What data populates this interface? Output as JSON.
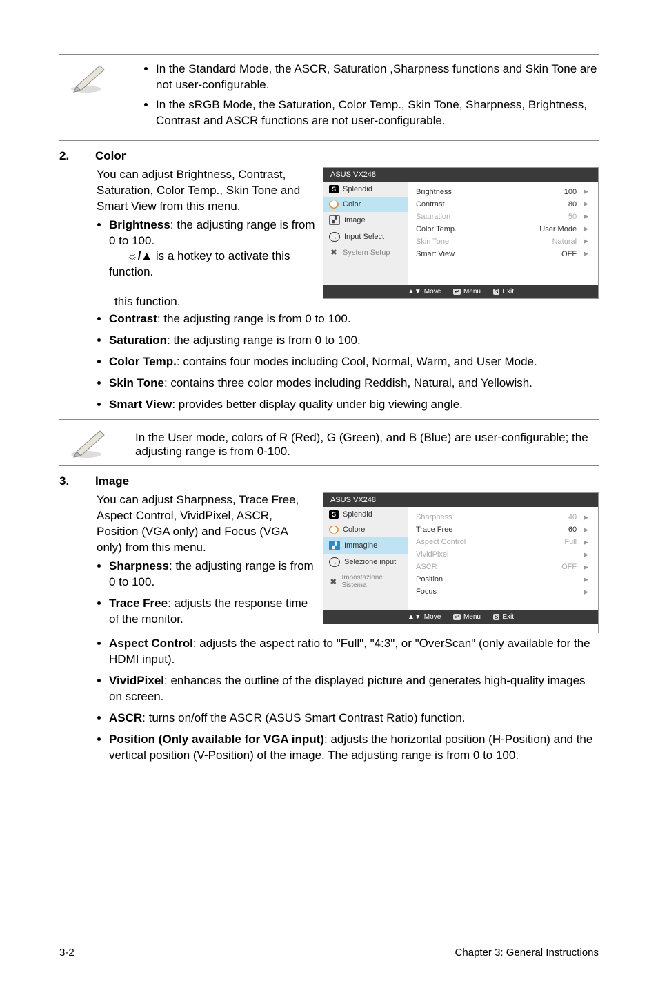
{
  "note1": {
    "b1": "In the Standard Mode, the ASCR, Saturation ,Sharpness functions and Skin Tone are not user-configurable.",
    "b2": "In the sRGB Mode, the Saturation, Color Temp., Skin Tone, Sharpness, Brightness, Contrast and ASCR functions are not user-configurable."
  },
  "s2": {
    "num": "2.",
    "title": "Color",
    "intro": "You can adjust Brightness, Contrast, Saturation, Color Temp., Skin Tone and Smart View from this menu.",
    "b_brightness_lead": "Brightness",
    "b_brightness_rest1": ": the adjusting range is from 0 to 100.",
    "b_brightness_rest2": " is a hotkey to activate this function.",
    "b_contrast_lead": "Contrast",
    "b_contrast_rest": ": the adjusting range is from 0 to 100.",
    "b_sat_lead": "Saturation",
    "b_sat_rest": ": the adjusting range is from 0 to 100.",
    "b_ct_lead": "Color Temp.",
    "b_ct_rest": ": contains four modes including Cool, Normal, Warm, and User Mode.",
    "b_st_lead": "Skin Tone",
    "b_st_rest": ": contains three color modes including Reddish, Natural, and Yellowish.",
    "b_sv_lead": "Smart View",
    "b_sv_rest": ": provides better display quality under big viewing angle."
  },
  "osd1": {
    "title": "ASUS VX248",
    "side": [
      "Splendid",
      "Color",
      "Image",
      "Input Select",
      "System Setup"
    ],
    "rows": [
      {
        "l": "Brightness",
        "v": "100",
        "d": false
      },
      {
        "l": "Contrast",
        "v": "80",
        "d": false
      },
      {
        "l": "Saturation",
        "v": "50",
        "d": true
      },
      {
        "l": "Color Temp.",
        "v": "User Mode",
        "d": false
      },
      {
        "l": "Skin Tone",
        "v": "Natural",
        "d": true
      },
      {
        "l": "Smart View",
        "v": "OFF",
        "d": false
      }
    ],
    "foot": {
      "move": "Move",
      "menu": "Menu",
      "exit": "Exit"
    }
  },
  "note2": "In the User mode, colors of R (Red), G (Green), and B (Blue) are user-configurable; the adjusting range is from 0-100.",
  "s3": {
    "num": "3.",
    "title": "Image",
    "intro": "You can adjust Sharpness, Trace Free, Aspect Control, VividPixel, ASCR, Position (VGA only) and Focus (VGA only) from this menu.",
    "b_sharp_lead": "Sharpness",
    "b_sharp_rest": ": the adjusting range is from 0 to 100.",
    "b_tf_lead": "Trace Free",
    "b_tf_rest": ": adjusts the response time of the monitor.",
    "b_ac_lead": "Aspect Control",
    "b_ac_rest": ": adjusts the aspect ratio to \"Full\", \"4:3\", or \"OverScan\" (only available for the HDMI input).",
    "b_vp_lead": "VividPixel",
    "b_vp_rest": ": enhances the outline of the displayed picture and generates high-quality images on screen.",
    "b_ascr_lead": "ASCR",
    "b_ascr_rest": ": turns on/off the ASCR (ASUS Smart Contrast Ratio) function.",
    "b_pos_lead": "Position (Only available for VGA input)",
    "b_pos_rest": ": adjusts the horizontal position (H-Position) and the vertical position (V-Position) of the image. The adjusting range is from 0 to 100."
  },
  "osd2": {
    "title": "ASUS VX248",
    "side": [
      "Splendid",
      "Colore",
      "Immagine",
      "Selezione input",
      "Impostazione Sistema"
    ],
    "rows": [
      {
        "l": "Sharpness",
        "v": "40",
        "d": true
      },
      {
        "l": "Trace Free",
        "v": "60",
        "d": false
      },
      {
        "l": "Aspect Control",
        "v": "Full",
        "d": true
      },
      {
        "l": "VividPixel",
        "v": "",
        "d": true
      },
      {
        "l": "ASCR",
        "v": "OFF",
        "d": true
      },
      {
        "l": "Position",
        "v": "",
        "d": false
      },
      {
        "l": "Focus",
        "v": "",
        "d": false
      }
    ],
    "foot": {
      "move": "Move",
      "menu": "Menu",
      "exit": "Exit"
    }
  },
  "footer": {
    "left": "3-2",
    "right": "Chapter 3: General Instructions"
  }
}
